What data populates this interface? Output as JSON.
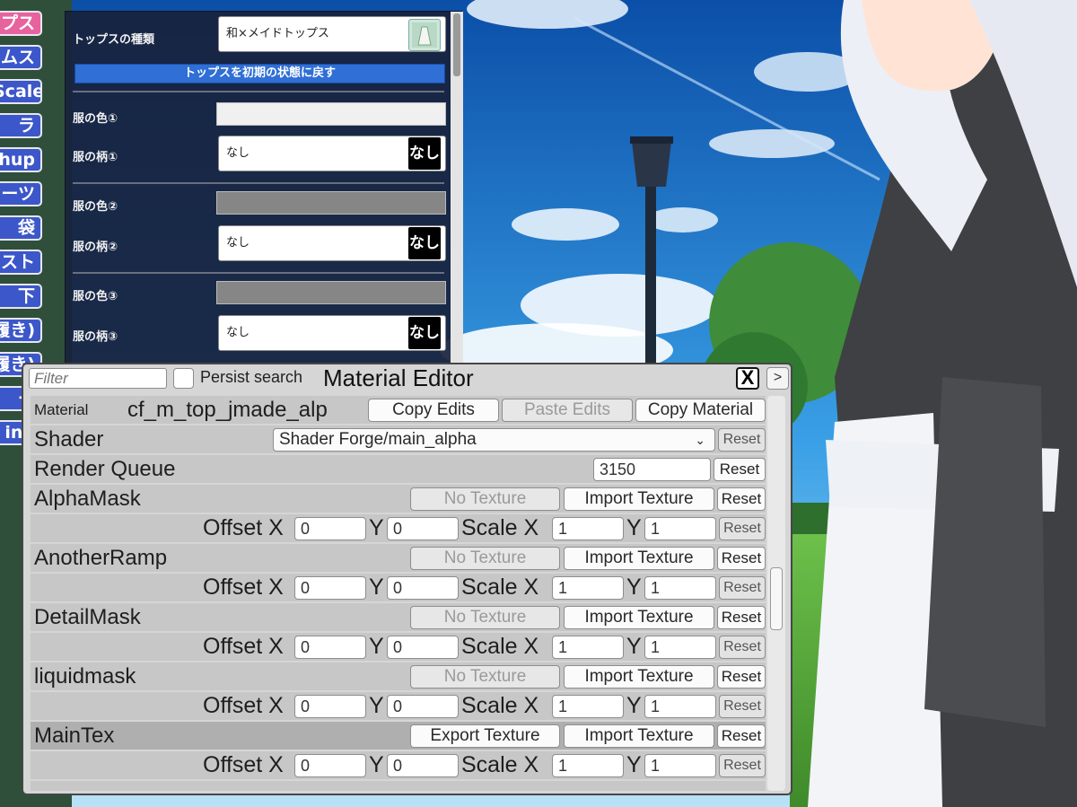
{
  "side_tabs": [
    "プス",
    "ムス",
    "Scale",
    "ラ",
    "hup",
    "ーツ",
    "袋",
    "スト",
    "下",
    "履き)",
    "履き)",
    "ー",
    "ing"
  ],
  "options_panel": {
    "tops_label": "トップスの種類",
    "tops_value": "和×メイドトップス",
    "reset_button": "トップスを初期の状態に戻す",
    "color1_label": "服の色①",
    "pattern1_label": "服の柄①",
    "pattern1_value": "なし",
    "pattern1_thumb": "なし",
    "color2_label": "服の色②",
    "pattern2_label": "服の柄②",
    "pattern2_value": "なし",
    "pattern2_thumb": "なし",
    "color3_label": "服の色③",
    "pattern3_label": "服の柄③",
    "pattern3_value": "なし",
    "pattern3_thumb": "なし",
    "colors": {
      "color1": "#f0f0f0",
      "color2": "#868686",
      "color3": "#868686"
    }
  },
  "material_editor": {
    "title": "Material Editor",
    "filter_placeholder": "Filter",
    "persist_search": "Persist search",
    "close_label": "X",
    "more_label": ">",
    "material_label": "Material",
    "material_name": "cf_m_top_jmade_alp",
    "copy_edits": "Copy Edits",
    "paste_edits": "Paste Edits",
    "copy_material": "Copy Material",
    "shader_label": "Shader",
    "shader_value": "Shader Forge/main_alpha",
    "render_queue_label": "Render Queue",
    "render_queue_value": "3150",
    "reset": "Reset",
    "no_texture": "No Texture",
    "import_texture": "Import Texture",
    "export_texture": "Export Texture",
    "offset_x": "Offset X",
    "y": "Y",
    "scale_x": "Scale X",
    "textures": [
      {
        "name": "AlphaMask",
        "offset_x": "0",
        "offset_y": "0",
        "scale_x": "1",
        "scale_y": "1"
      },
      {
        "name": "AnotherRamp",
        "offset_x": "0",
        "offset_y": "0",
        "scale_x": "1",
        "scale_y": "1"
      },
      {
        "name": "DetailMask",
        "offset_x": "0",
        "offset_y": "0",
        "scale_x": "1",
        "scale_y": "1"
      },
      {
        "name": "liquidmask",
        "offset_x": "0",
        "offset_y": "0",
        "scale_x": "1",
        "scale_y": "1"
      },
      {
        "name": "MainTex",
        "offset_x": "0",
        "offset_y": "0",
        "scale_x": "1",
        "scale_y": "1"
      }
    ]
  }
}
